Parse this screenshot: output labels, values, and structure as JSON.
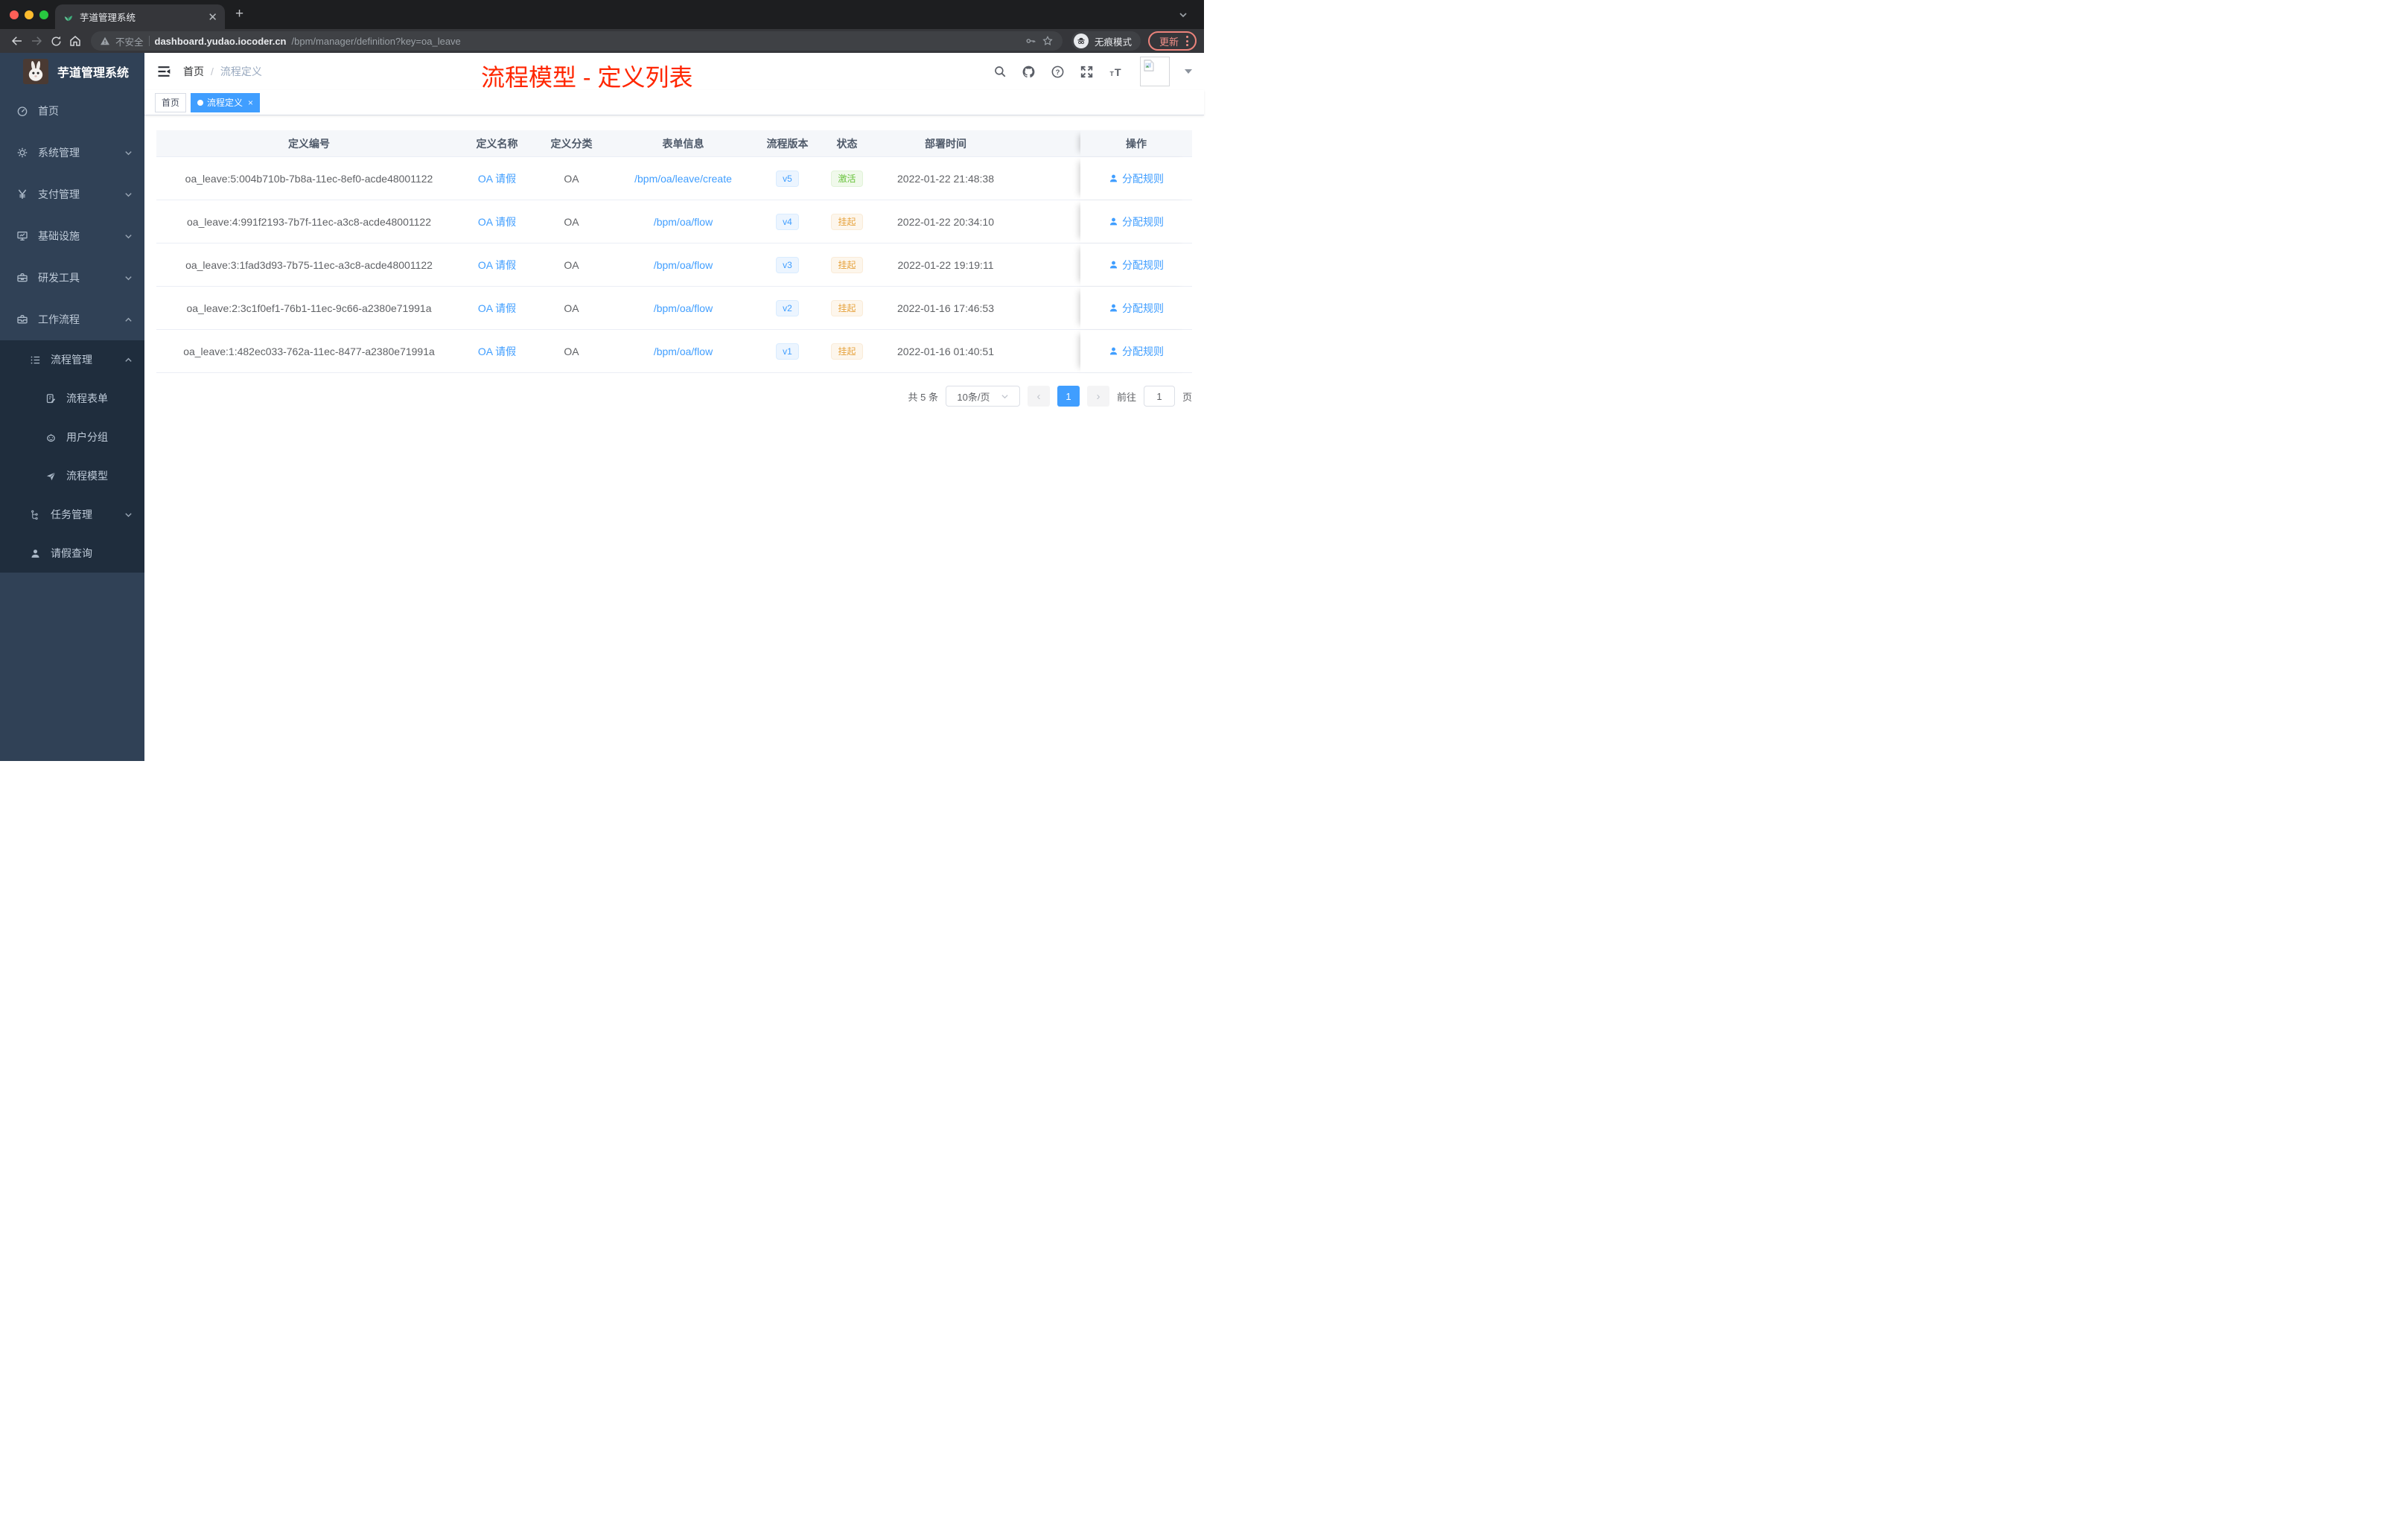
{
  "colors": {
    "accent": "#409eff",
    "sidebar": "#304156",
    "submenu": "#1f2d3d",
    "sidebarText": "#bfcbd9",
    "red": "#ff2600",
    "success": "#67c23a",
    "warning": "#e6a23c"
  },
  "browser": {
    "tab_title": "芋道管理系统",
    "tab_close": "✕",
    "new_tab": "+",
    "security_label": "不安全",
    "url_host": "dashboard.yudao.iocoder.cn",
    "url_path": "/bpm/manager/definition?key=oa_leave",
    "incognito_label": "无痕模式",
    "update_label": "更新"
  },
  "sidebar": {
    "title": "芋道管理系统",
    "menu": [
      {
        "label": "首页"
      },
      {
        "label": "系统管理"
      },
      {
        "label": "支付管理"
      },
      {
        "label": "基础设施"
      },
      {
        "label": "研发工具"
      },
      {
        "label": "工作流程"
      }
    ],
    "submenu": [
      {
        "label": "流程管理"
      },
      {
        "label": "流程表单"
      },
      {
        "label": "用户分组"
      },
      {
        "label": "流程模型"
      },
      {
        "label": "任务管理"
      },
      {
        "label": "请假查询"
      }
    ]
  },
  "header": {
    "breadcrumb_home": "首页",
    "breadcrumb_sep": "/",
    "breadcrumb_current": "流程定义",
    "annotation": "流程模型 - 定义列表"
  },
  "tags": {
    "home": "首页",
    "active": "流程定义",
    "close": "×"
  },
  "table": {
    "columns": [
      "定义编号",
      "定义名称",
      "定义分类",
      "表单信息",
      "流程版本",
      "状态",
      "部署时间",
      "操作"
    ],
    "rows": [
      {
        "id": "oa_leave:5:004b710b-7b8a-11ec-8ef0-acde48001122",
        "name": "OA 请假",
        "category": "OA",
        "form": "/bpm/oa/leave/create",
        "version": "v5",
        "status": "激活",
        "time": "2022-01-22 21:48:38",
        "action": "分配规则"
      },
      {
        "id": "oa_leave:4:991f2193-7b7f-11ec-a3c8-acde48001122",
        "name": "OA 请假",
        "category": "OA",
        "form": "/bpm/oa/flow",
        "version": "v4",
        "status": "挂起",
        "time": "2022-01-22 20:34:10",
        "action": "分配规则"
      },
      {
        "id": "oa_leave:3:1fad3d93-7b75-11ec-a3c8-acde48001122",
        "name": "OA 请假",
        "category": "OA",
        "form": "/bpm/oa/flow",
        "version": "v3",
        "status": "挂起",
        "time": "2022-01-22 19:19:11",
        "action": "分配规则"
      },
      {
        "id": "oa_leave:2:3c1f0ef1-76b1-11ec-9c66-a2380e71991a",
        "name": "OA 请假",
        "category": "OA",
        "form": "/bpm/oa/flow",
        "version": "v2",
        "status": "挂起",
        "time": "2022-01-16 17:46:53",
        "action": "分配规则"
      },
      {
        "id": "oa_leave:1:482ec033-762a-11ec-8477-a2380e71991a",
        "name": "OA 请假",
        "category": "OA",
        "form": "/bpm/oa/flow",
        "version": "v1",
        "status": "挂起",
        "time": "2022-01-16 01:40:51",
        "action": "分配规则"
      }
    ]
  },
  "pagination": {
    "total": "共 5 条",
    "size": "10条/页",
    "prev": "‹",
    "page": "1",
    "next": "›",
    "goto_label": "前往",
    "goto_value": "1",
    "unit": "页"
  }
}
